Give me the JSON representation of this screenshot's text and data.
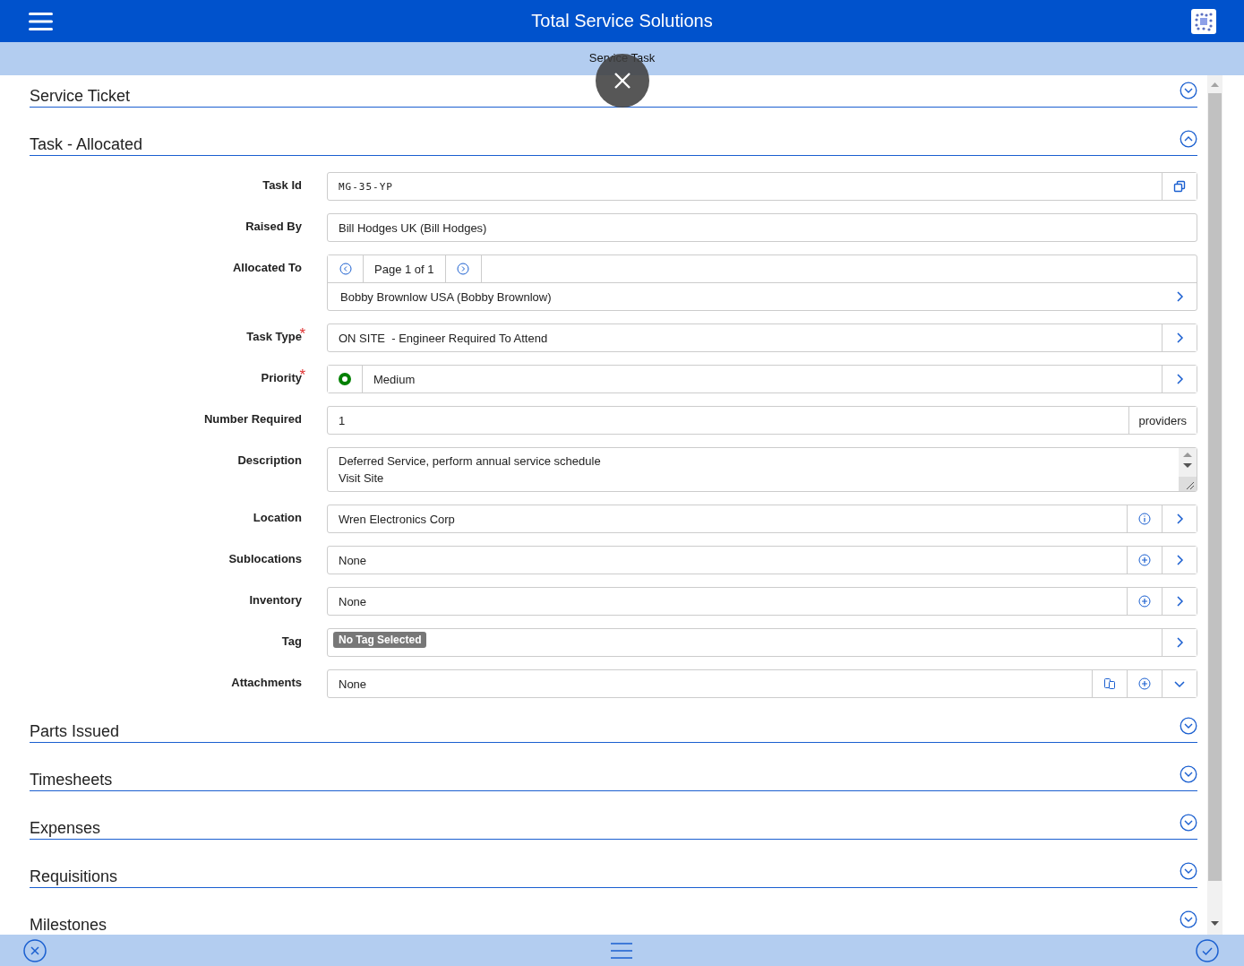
{
  "app_bar": {
    "title": "Total Service Solutions"
  },
  "sub_bar": {
    "title": "Service Task"
  },
  "sections": [
    {
      "title": "Service Ticket",
      "expanded": false
    },
    {
      "title": "Task  -  Allocated",
      "expanded": true,
      "fields": [
        {
          "label": "Task Id",
          "kind": "mono",
          "value": "MG-35-YP",
          "actions": [
            {
              "kind": "copy"
            }
          ]
        },
        {
          "label": "Raised By",
          "kind": "text",
          "value": "Bill Hodges UK (Bill Hodges)"
        },
        {
          "label": "Allocated To",
          "kind": "pager",
          "page": "Page 1 of 1",
          "value": "Bobby Brownlow USA (Bobby Brownlow)"
        },
        {
          "label": "Task Type",
          "kind": "text",
          "required_mark": "*",
          "value": "ON SITE  - Engineer Required To Attend",
          "actions": [
            {
              "kind": "chevron-right"
            }
          ]
        },
        {
          "label": "Priority",
          "kind": "priority",
          "required_mark": "*",
          "color": "#008000",
          "value": "Medium",
          "actions": [
            {
              "kind": "chevron-right"
            }
          ]
        },
        {
          "label": "Number Required",
          "kind": "number",
          "value": "1",
          "unit": "providers"
        },
        {
          "label": "Description",
          "kind": "textarea",
          "value": "Deferred Service, perform annual service schedule\nVisit Site"
        },
        {
          "label": "Location",
          "kind": "text",
          "value": "Wren Electronics Corp",
          "actions": [
            {
              "kind": "info"
            },
            {
              "kind": "chevron-right"
            }
          ]
        },
        {
          "label": "Sublocations",
          "kind": "text",
          "value": "None",
          "actions": [
            {
              "kind": "plus"
            },
            {
              "kind": "chevron-right"
            }
          ]
        },
        {
          "label": "Inventory",
          "kind": "text",
          "value": "None",
          "actions": [
            {
              "kind": "plus"
            },
            {
              "kind": "chevron-right"
            }
          ]
        },
        {
          "label": "Tag",
          "kind": "tag",
          "value": "No Tag Selected",
          "actions": [
            {
              "kind": "chevron-right"
            }
          ]
        },
        {
          "label": "Attachments",
          "kind": "text",
          "value": "None",
          "actions": [
            {
              "kind": "copy-files"
            },
            {
              "kind": "plus"
            },
            {
              "kind": "chevron-down"
            }
          ]
        }
      ]
    },
    {
      "title": "Parts Issued",
      "expanded": false
    },
    {
      "title": "Timesheets",
      "expanded": false
    },
    {
      "title": "Expenses",
      "expanded": false
    },
    {
      "title": "Requisitions",
      "expanded": false
    },
    {
      "title": "Milestones",
      "expanded": false
    }
  ]
}
